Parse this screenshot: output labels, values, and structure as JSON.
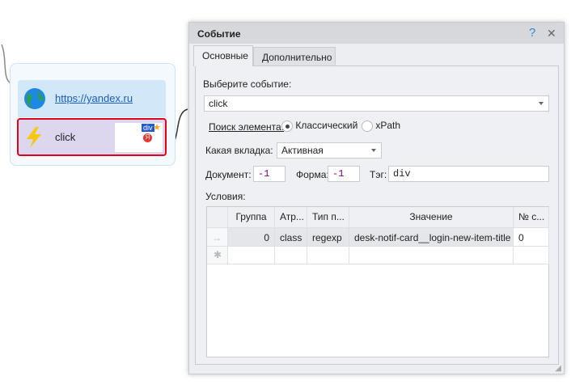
{
  "canvas": {
    "nodes": [
      {
        "label": "https://yandex.ru",
        "icon": "globe-icon"
      },
      {
        "label": "click",
        "icon": "lightning-icon",
        "thumb_tag": "div",
        "thumb_letter": "Я"
      }
    ]
  },
  "dialog": {
    "title": "Событие",
    "help": "?",
    "close": "✕",
    "tabs": [
      {
        "label": "Основные",
        "active": true
      },
      {
        "label": "Дополнительно",
        "active": false
      }
    ],
    "event_label": "Выберите событие:",
    "event_value": "click",
    "search_label": "Поиск элемента:",
    "radio": [
      {
        "label": "Классический",
        "checked": true
      },
      {
        "label": "xPath",
        "checked": false
      }
    ],
    "tab_label": "Какая вкладка:",
    "tab_value": "Активная",
    "doc_label": "Документ:",
    "doc_value": "-1",
    "form_label": "Форма:",
    "form_value": "-1",
    "tag_label": "Тэг:",
    "tag_value": "div",
    "conditions_label": "Условия:",
    "grid": {
      "columns": [
        "Группа",
        "Атр...",
        "Тип п...",
        "Значение",
        "№ с..."
      ],
      "rows": [
        [
          "0",
          "class",
          "regexp",
          "desk-notif-card__login-new-item-title",
          "0"
        ]
      ],
      "row_arrow": "→",
      "new_row": "✱"
    }
  }
}
